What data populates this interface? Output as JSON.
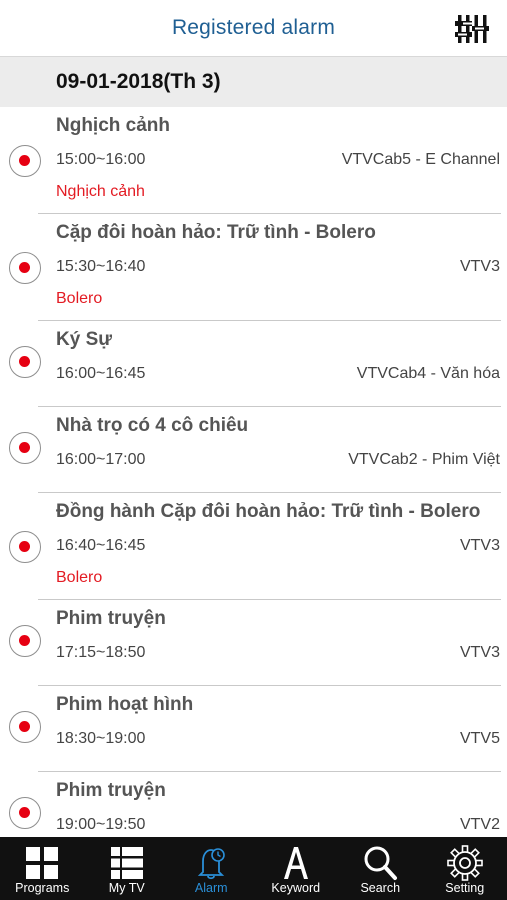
{
  "header": {
    "title": "Registered alarm",
    "settings_icon": "sliders-icon"
  },
  "date_header": "09-01-2018(Th 3)",
  "colors": {
    "header_title": "#1f5f93",
    "record_dot": "#e60012",
    "keyword": "#e31b23",
    "tab_active": "#2a8fd8",
    "tabbar_bg": "#111111"
  },
  "alarms": [
    {
      "title": "Nghịch cảnh",
      "time": "15:00~16:00",
      "channel": "VTVCab5 - E Channel",
      "keyword": "Nghịch cảnh"
    },
    {
      "title": "Cặp đôi hoàn hảo: Trữ tình - Bolero",
      "time": "15:30~16:40",
      "channel": "VTV3",
      "keyword": "Bolero"
    },
    {
      "title": "Ký Sự",
      "time": "16:00~16:45",
      "channel": "VTVCab4 - Văn hóa",
      "keyword": ""
    },
    {
      "title": "Nhà trọ có 4 cô chiêu",
      "time": "16:00~17:00",
      "channel": "VTVCab2 - Phim Việt",
      "keyword": ""
    },
    {
      "title": "Đồng hành Cặp đôi hoàn hảo: Trữ tình - Bolero",
      "time": "16:40~16:45",
      "channel": "VTV3",
      "keyword": "Bolero"
    },
    {
      "title": "Phim truyện",
      "time": "17:15~18:50",
      "channel": "VTV3",
      "keyword": ""
    },
    {
      "title": "Phim hoạt hình",
      "time": "18:30~19:00",
      "channel": "VTV5",
      "keyword": ""
    },
    {
      "title": "Phim truyện",
      "time": "19:00~19:50",
      "channel": "VTV2",
      "keyword": ""
    }
  ],
  "tabs": [
    {
      "label": "Programs",
      "icon": "grid-icon",
      "active": false
    },
    {
      "label": "My TV",
      "icon": "list-grid-icon",
      "active": false
    },
    {
      "label": "Alarm",
      "icon": "bell-clock-icon",
      "active": true
    },
    {
      "label": "Keyword",
      "icon": "letter-a-icon",
      "active": false
    },
    {
      "label": "Search",
      "icon": "search-icon",
      "active": false
    },
    {
      "label": "Setting",
      "icon": "gear-icon",
      "active": false
    }
  ]
}
